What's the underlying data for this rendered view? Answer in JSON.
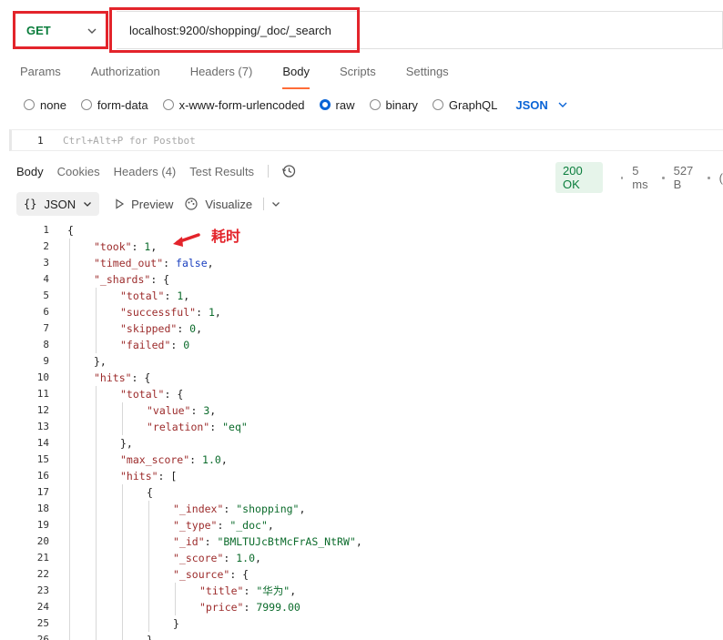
{
  "request": {
    "method": "GET",
    "url": "localhost:9200/shopping/_doc/_search"
  },
  "request_tabs": [
    "Params",
    "Authorization",
    "Headers (7)",
    "Body",
    "Scripts",
    "Settings"
  ],
  "body_types": {
    "options": [
      "none",
      "form-data",
      "x-www-form-urlencoded",
      "raw",
      "binary",
      "GraphQL"
    ],
    "format": "JSON"
  },
  "request_editor": {
    "line_number": "1",
    "placeholder": "Ctrl+Alt+P for Postbot"
  },
  "response_tabs": [
    "Body",
    "Cookies",
    "Headers (4)",
    "Test Results"
  ],
  "response_meta": {
    "status": "200 OK",
    "time": "5 ms",
    "size": "527 B",
    "extra": "("
  },
  "response_toolbar": {
    "format": "JSON",
    "preview": "Preview",
    "visualize": "Visualize"
  },
  "annotation": "耗时",
  "code_lines": [
    {
      "n": "1",
      "i": 0,
      "t": "{"
    },
    {
      "n": "2",
      "i": 1,
      "t": "\"took\": 1,"
    },
    {
      "n": "3",
      "i": 1,
      "t": "\"timed_out\": false,"
    },
    {
      "n": "4",
      "i": 1,
      "t": "\"_shards\": {"
    },
    {
      "n": "5",
      "i": 2,
      "t": "\"total\": 1,"
    },
    {
      "n": "6",
      "i": 2,
      "t": "\"successful\": 1,"
    },
    {
      "n": "7",
      "i": 2,
      "t": "\"skipped\": 0,"
    },
    {
      "n": "8",
      "i": 2,
      "t": "\"failed\": 0"
    },
    {
      "n": "9",
      "i": 1,
      "t": "},"
    },
    {
      "n": "10",
      "i": 1,
      "t": "\"hits\": {"
    },
    {
      "n": "11",
      "i": 2,
      "t": "\"total\": {"
    },
    {
      "n": "12",
      "i": 3,
      "t": "\"value\": 3,"
    },
    {
      "n": "13",
      "i": 3,
      "t": "\"relation\": \"eq\""
    },
    {
      "n": "14",
      "i": 2,
      "t": "},"
    },
    {
      "n": "15",
      "i": 2,
      "t": "\"max_score\": 1.0,"
    },
    {
      "n": "16",
      "i": 2,
      "t": "\"hits\": ["
    },
    {
      "n": "17",
      "i": 3,
      "t": "{"
    },
    {
      "n": "18",
      "i": 4,
      "t": "\"_index\": \"shopping\","
    },
    {
      "n": "19",
      "i": 4,
      "t": "\"_type\": \"_doc\","
    },
    {
      "n": "20",
      "i": 4,
      "t": "\"_id\": \"BMLTUJcBtMcFrAS_NtRW\","
    },
    {
      "n": "21",
      "i": 4,
      "t": "\"_score\": 1.0,"
    },
    {
      "n": "22",
      "i": 4,
      "t": "\"_source\": {"
    },
    {
      "n": "23",
      "i": 5,
      "t": "\"title\": \"华为\","
    },
    {
      "n": "24",
      "i": 5,
      "t": "\"price\": 7999.00"
    },
    {
      "n": "25",
      "i": 4,
      "t": "}"
    },
    {
      "n": "26",
      "i": 3,
      "t": "}"
    }
  ]
}
